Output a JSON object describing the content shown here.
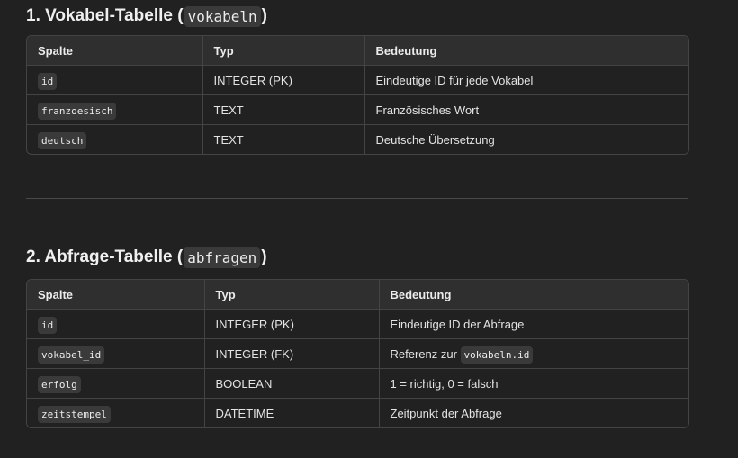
{
  "section1": {
    "title_prefix": "1. Vokabel-Tabelle (",
    "title_code": "vokabeln",
    "title_suffix": ")",
    "headers": [
      "Spalte",
      "Typ",
      "Bedeutung"
    ],
    "rows": [
      {
        "col": "id",
        "type": "INTEGER (PK)",
        "desc": "Eindeutige ID für jede Vokabel"
      },
      {
        "col": "franzoesisch",
        "type": "TEXT",
        "desc": "Französisches Wort"
      },
      {
        "col": "deutsch",
        "type": "TEXT",
        "desc": "Deutsche Übersetzung"
      }
    ]
  },
  "section2": {
    "title_prefix": "2. Abfrage-Tabelle (",
    "title_code": "abfragen",
    "title_suffix": ")",
    "headers": [
      "Spalte",
      "Typ",
      "Bedeutung"
    ],
    "rows": [
      {
        "col": "id",
        "type": "INTEGER (PK)",
        "desc": "Eindeutige ID der Abfrage"
      },
      {
        "col": "vokabel_id",
        "type": "INTEGER (FK)",
        "desc_prefix": "Referenz zur ",
        "desc_code": "vokabeln.id"
      },
      {
        "col": "erfolg",
        "type": "BOOLEAN",
        "desc": "1 = richtig, 0 = falsch"
      },
      {
        "col": "zeitstempel",
        "type": "DATETIME",
        "desc": "Zeitpunkt der Abfrage"
      }
    ]
  }
}
